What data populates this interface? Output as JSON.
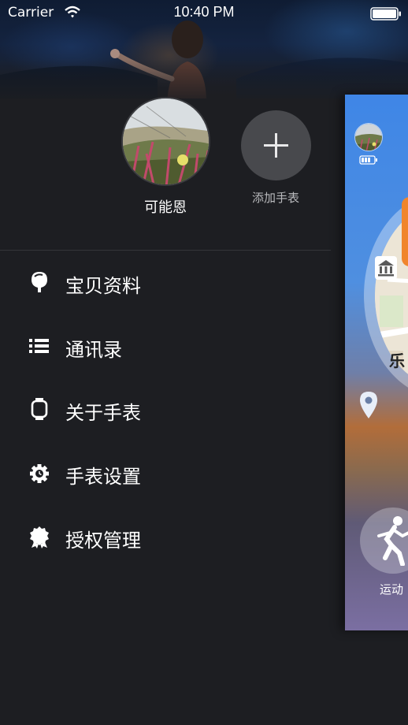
{
  "status_bar": {
    "carrier": "Carrier",
    "time": "10:40 PM"
  },
  "profile": {
    "name": "可能恩"
  },
  "add_watch": {
    "label": "添加手表"
  },
  "menu": [
    {
      "label": "宝贝资料",
      "icon": "child-head-icon"
    },
    {
      "label": "通讯录",
      "icon": "list-icon"
    },
    {
      "label": "关于手表",
      "icon": "watch-icon"
    },
    {
      "label": "手表设置",
      "icon": "gear-clock-icon"
    },
    {
      "label": "授权管理",
      "icon": "badge-icon"
    }
  ],
  "main_preview": {
    "map_text": "乐",
    "sport_label": "运动"
  },
  "colors": {
    "drawer_bg": "#1d1e22",
    "accent_orange": "#f0852c",
    "main_blue": "#3f86e6"
  }
}
